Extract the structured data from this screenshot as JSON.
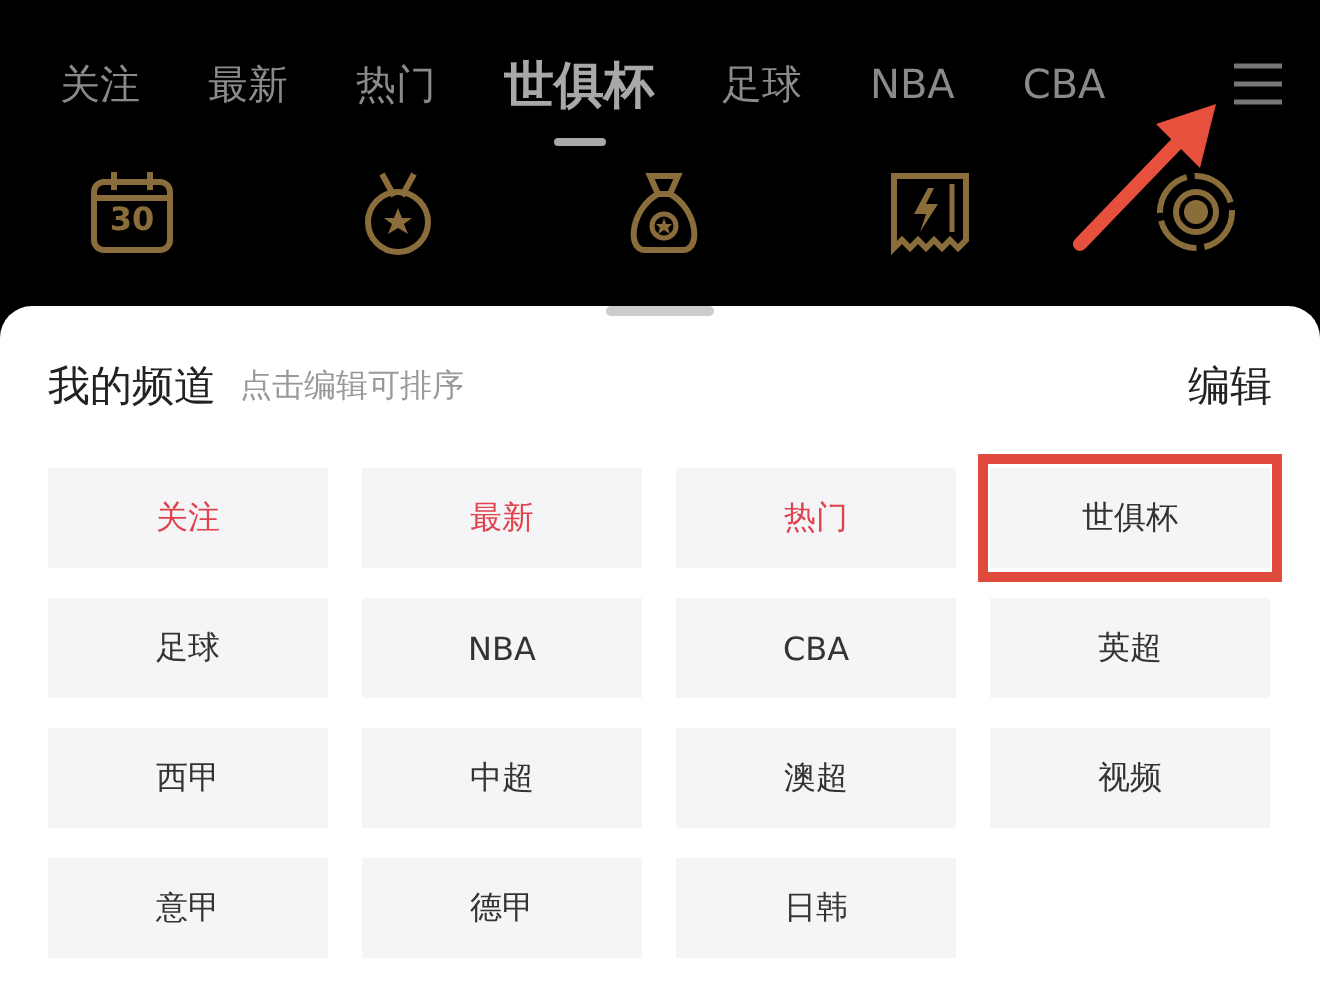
{
  "top_tabs": [
    {
      "label": "关注",
      "selected": false
    },
    {
      "label": "最新",
      "selected": false
    },
    {
      "label": "热门",
      "selected": false
    },
    {
      "label": "世俱杯",
      "selected": true
    },
    {
      "label": "足球",
      "selected": false
    },
    {
      "label": "NBA",
      "selected": false
    },
    {
      "label": "CBA",
      "selected": false
    }
  ],
  "menu_button": {
    "highlighted": true
  },
  "shortcuts": [
    {
      "kind": "calendar",
      "text": "30"
    },
    {
      "kind": "medal"
    },
    {
      "kind": "bag"
    },
    {
      "kind": "card"
    },
    {
      "kind": "target"
    }
  ],
  "channel_sheet": {
    "title": "我的频道",
    "hint": "点击编辑可排序",
    "edit": "编辑",
    "channels": [
      {
        "label": "关注",
        "fixed": true,
        "highlighted": false
      },
      {
        "label": "最新",
        "fixed": true,
        "highlighted": false
      },
      {
        "label": "热门",
        "fixed": true,
        "highlighted": false
      },
      {
        "label": "世俱杯",
        "fixed": false,
        "highlighted": true
      },
      {
        "label": "足球",
        "fixed": false,
        "highlighted": false
      },
      {
        "label": "NBA",
        "fixed": false,
        "highlighted": false
      },
      {
        "label": "CBA",
        "fixed": false,
        "highlighted": false
      },
      {
        "label": "英超",
        "fixed": false,
        "highlighted": false
      },
      {
        "label": "西甲",
        "fixed": false,
        "highlighted": false
      },
      {
        "label": "中超",
        "fixed": false,
        "highlighted": false
      },
      {
        "label": "澳超",
        "fixed": false,
        "highlighted": false
      },
      {
        "label": "视频",
        "fixed": false,
        "highlighted": false
      },
      {
        "label": "意甲",
        "fixed": false,
        "highlighted": false
      },
      {
        "label": "德甲",
        "fixed": false,
        "highlighted": false
      },
      {
        "label": "日韩",
        "fixed": false,
        "highlighted": false
      }
    ]
  }
}
